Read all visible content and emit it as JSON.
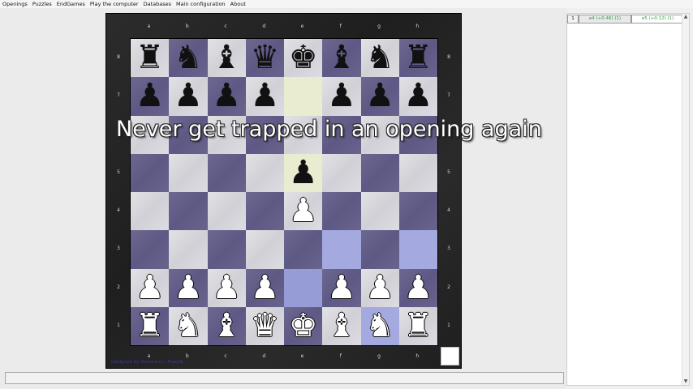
{
  "menu": [
    "Openings",
    "Puzzles",
    "EndGames",
    "Play the computer",
    "Databases",
    "Main configuration",
    "About"
  ],
  "overlay_title": "Never get trapped in an opening again",
  "credit": "Designed by Vectorium / Freepik",
  "files": [
    "a",
    "b",
    "c",
    "d",
    "e",
    "f",
    "g",
    "h"
  ],
  "ranks": [
    "8",
    "7",
    "6",
    "5",
    "4",
    "3",
    "2",
    "1"
  ],
  "board": [
    [
      "br",
      "bn",
      "bb",
      "bq",
      "bk",
      "bb",
      "bn",
      "br"
    ],
    [
      "bp",
      "bp",
      "bp",
      "bp",
      "",
      "bp",
      "bp",
      "bp"
    ],
    [
      "",
      "",
      "",
      "",
      "",
      "",
      "",
      ""
    ],
    [
      "",
      "",
      "",
      "",
      "bp",
      "",
      "",
      ""
    ],
    [
      "",
      "",
      "",
      "",
      "wp",
      "",
      "",
      ""
    ],
    [
      "",
      "",
      "",
      "",
      "",
      "",
      "",
      ""
    ],
    [
      "wp",
      "wp",
      "wp",
      "wp",
      "",
      "wp",
      "wp",
      "wp"
    ],
    [
      "wr",
      "wn",
      "wb",
      "wq",
      "wk",
      "wb",
      "wn",
      "wr"
    ]
  ],
  "highlights": {
    "e7": "hl-light",
    "e5": "hl-light",
    "f3": "hl-blue",
    "h3": "hl-blue",
    "e2": "hl-blue2",
    "g1": "hl-blue"
  },
  "moves": [
    {
      "num": "1",
      "white": "e4 (+0.46) (1)",
      "black": "e5 (+0.12) (1)"
    }
  ],
  "scroll": {
    "up": "▲",
    "down": "▼"
  },
  "colors": {
    "light_square": "#dcdce2",
    "dark_square": "#64608a",
    "frame": "#1f1f1f",
    "move_text": "#2a9a3e"
  }
}
